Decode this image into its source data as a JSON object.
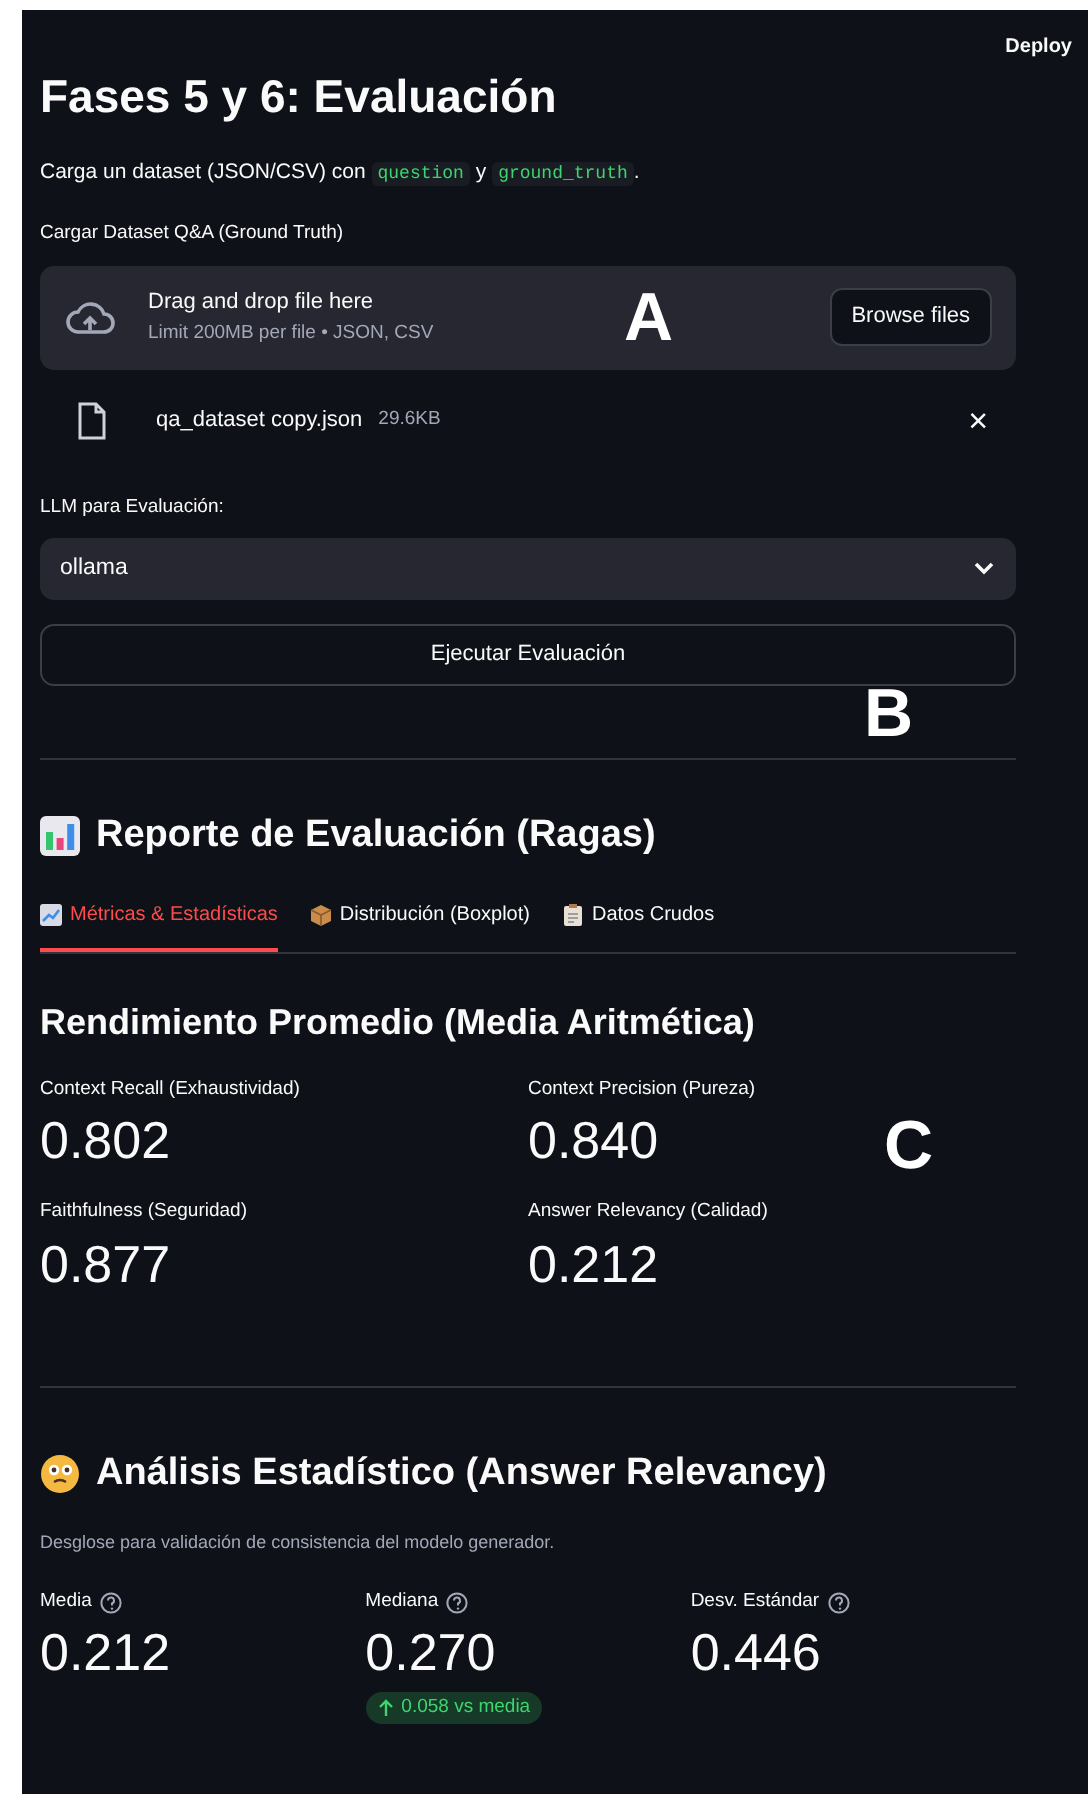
{
  "header": {
    "deploy": "Deploy"
  },
  "title": "Fases 5 y 6: Evaluación",
  "intro": [
    {
      "kind": "text",
      "text": "Carga un dataset (JSON/CSV) con "
    },
    {
      "kind": "code",
      "text": "question"
    },
    {
      "kind": "text",
      "text": " y "
    },
    {
      "kind": "code",
      "text": "ground_truth"
    },
    {
      "kind": "text",
      "text": "."
    }
  ],
  "uploader": {
    "label": "Cargar Dataset Q&A (Ground Truth)",
    "drop_title": "Drag and drop file here",
    "drop_hint": "Limit 200MB per file • JSON, CSV",
    "button": "Browse files",
    "annotation": "A",
    "file": {
      "name": "qa_dataset copy.json",
      "size": "29.6KB",
      "remove": "×"
    }
  },
  "llm_select": {
    "label": "LLM para Evaluación:",
    "value": "ollama"
  },
  "run_button": {
    "label": "Ejecutar Evaluación",
    "annotation": "B"
  },
  "report": {
    "heading": "Reporte de Evaluación (Ragas)",
    "tabs": [
      {
        "label": "Métricas & Estadísticas",
        "selected": true
      },
      {
        "label": "Distribución (Boxplot)",
        "selected": false
      },
      {
        "label": "Datos Crudos",
        "selected": false
      }
    ],
    "section_title": "Rendimiento Promedio (Media Aritmética)",
    "annotation": "C",
    "metrics": [
      {
        "label": "Context Recall (Exhaustividad)",
        "value": "0.802"
      },
      {
        "label": "Context Precision (Pureza)",
        "value": "0.840"
      },
      {
        "label": "Faithfulness (Seguridad)",
        "value": "0.877"
      },
      {
        "label": "Answer Relevancy (Calidad)",
        "value": "0.212"
      }
    ]
  },
  "stats": {
    "heading": "Análisis Estadístico (Answer Relevancy)",
    "caption": "Desglose para validación de consistencia del modelo generador.",
    "metrics": [
      {
        "label": "Media",
        "value": "0.212"
      },
      {
        "label": "Mediana",
        "value": "0.270",
        "delta": {
          "text": "0.058 vs media"
        }
      },
      {
        "label": "Desv. Estándar",
        "value": "0.446"
      }
    ]
  }
}
